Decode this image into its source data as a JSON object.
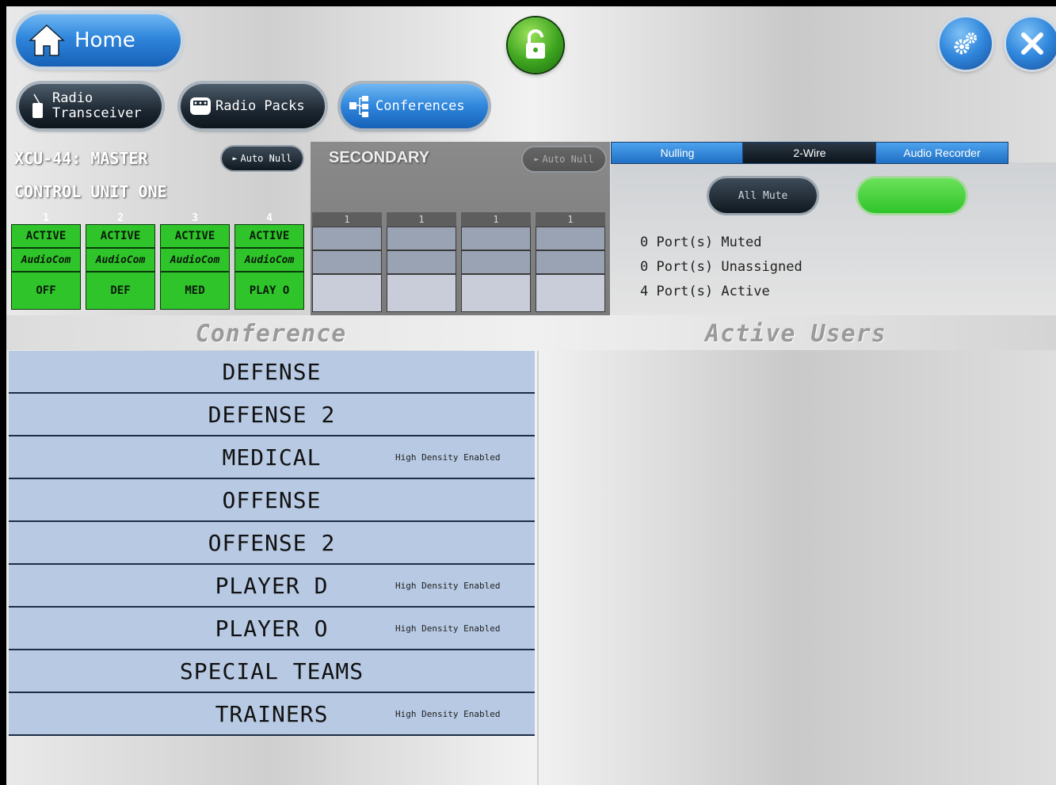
{
  "header": {
    "home_label": "Home",
    "lock_icon": "unlock-icon",
    "settings_icon": "gears-icon",
    "close_icon": "close-icon"
  },
  "tabs": [
    {
      "label_line1": "Radio",
      "label_line2": "Transceiver",
      "icon": "radio-icon"
    },
    {
      "label": "Radio Packs",
      "icon": "radio-pack-icon"
    },
    {
      "label": "Conferences",
      "icon": "conferences-icon",
      "active": true
    }
  ],
  "master": {
    "title": "XCU-44: MASTER",
    "subtitle": "CONTROL UNIT ONE",
    "auto_null": "Auto Null",
    "ports": [
      {
        "num": "1",
        "status": "ACTIVE",
        "type": "AudioCom",
        "conference": "OFF"
      },
      {
        "num": "2",
        "status": "ACTIVE",
        "type": "AudioCom",
        "conference": "DEF"
      },
      {
        "num": "3",
        "status": "ACTIVE",
        "type": "AudioCom",
        "conference": "MED"
      },
      {
        "num": "4",
        "status": "ACTIVE",
        "type": "AudioCom",
        "conference": "PLAY O"
      }
    ]
  },
  "secondary": {
    "title": "SECONDARY",
    "auto_null": "Auto Null",
    "ports": [
      {
        "num": "1"
      },
      {
        "num": "1"
      },
      {
        "num": "1"
      },
      {
        "num": "1"
      }
    ]
  },
  "right_tabs": [
    "Nulling",
    "2-Wire",
    "Audio Recorder"
  ],
  "buttons": {
    "all_mute": "All Mute",
    "all_active": ""
  },
  "stats": [
    "0 Port(s) Muted",
    "0 Port(s) Unassigned",
    "4 Port(s) Active"
  ],
  "section_headers": {
    "conference": "Conference",
    "active_users": "Active Users"
  },
  "conferences": [
    {
      "name": "DEFENSE",
      "note": ""
    },
    {
      "name": "DEFENSE 2",
      "note": ""
    },
    {
      "name": "MEDICAL",
      "note": "High Density Enabled"
    },
    {
      "name": "OFFENSE",
      "note": ""
    },
    {
      "name": "OFFENSE 2",
      "note": ""
    },
    {
      "name": "PLAYER D",
      "note": "High Density Enabled"
    },
    {
      "name": "PLAYER O",
      "note": "High Density Enabled"
    },
    {
      "name": "SPECIAL TEAMS",
      "note": ""
    },
    {
      "name": "TRAINERS",
      "note": "High Density Enabled"
    }
  ],
  "colors": {
    "accent_blue": "#2f86dc",
    "active_green": "#2fc42a",
    "list_blue": "#b7c9e3"
  }
}
